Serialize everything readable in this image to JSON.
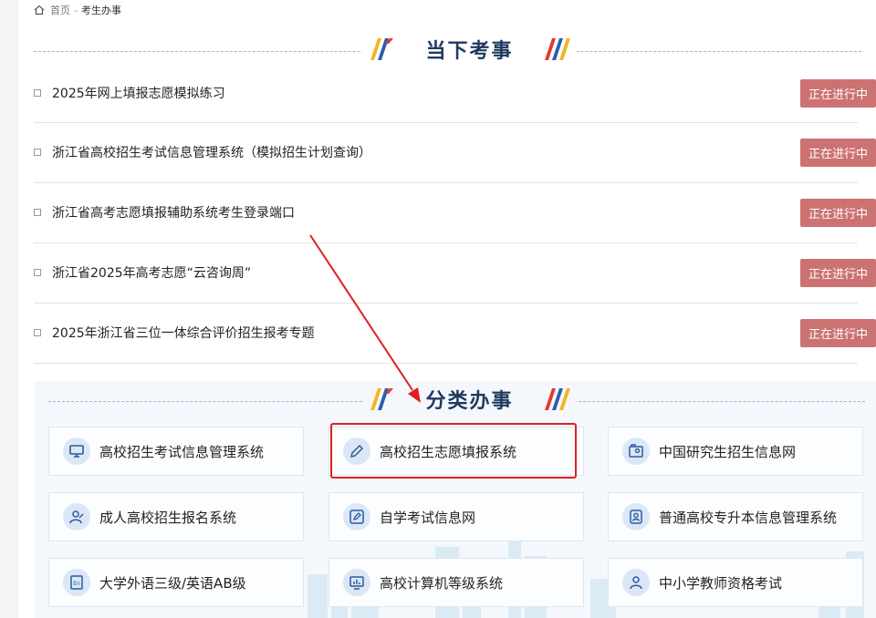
{
  "breadcrumb": {
    "home": "首页",
    "separator": "-",
    "current": "考生办事"
  },
  "current_events": {
    "title": "当下考事",
    "items": [
      {
        "label": "2025年网上填报志愿模拟练习",
        "status": "正在进行中"
      },
      {
        "label": "浙江省高校招生考试信息管理系统（模拟招生计划查询）",
        "status": "正在进行中"
      },
      {
        "label": "浙江省高考志愿填报辅助系统考生登录端口",
        "status": "正在进行中"
      },
      {
        "label": "浙江省2025年高考志愿“云咨询周”",
        "status": "正在进行中"
      },
      {
        "label": "2025年浙江省三位一体综合评价招生报考专题",
        "status": "正在进行中"
      }
    ]
  },
  "categories": {
    "title": "分类办事",
    "items": [
      {
        "label": "高校招生考试信息管理系统",
        "icon": "monitor-icon"
      },
      {
        "label": "高校招生志愿填报系统",
        "icon": "pencil-icon"
      },
      {
        "label": "中国研究生招生信息网",
        "icon": "graduate-id-icon"
      },
      {
        "label": "成人高校招生报名系统",
        "icon": "user-edit-icon"
      },
      {
        "label": "自学考试信息网",
        "icon": "edit-screen-icon"
      },
      {
        "label": "普通高校专升本信息管理系统",
        "icon": "user-badge-icon"
      },
      {
        "label": "大学外语三级/英语AB级",
        "icon": "en-book-icon"
      },
      {
        "label": "高校计算机等级系统",
        "icon": "bar-chart-icon"
      },
      {
        "label": "中小学教师资格考试",
        "icon": "teacher-icon"
      }
    ]
  },
  "colors": {
    "status_badge": "#cc7272",
    "title": "#1f3a60",
    "annotation": "#e02020",
    "icon_bg": "#dbe7f6",
    "icon_fg": "#2b5b9e"
  }
}
